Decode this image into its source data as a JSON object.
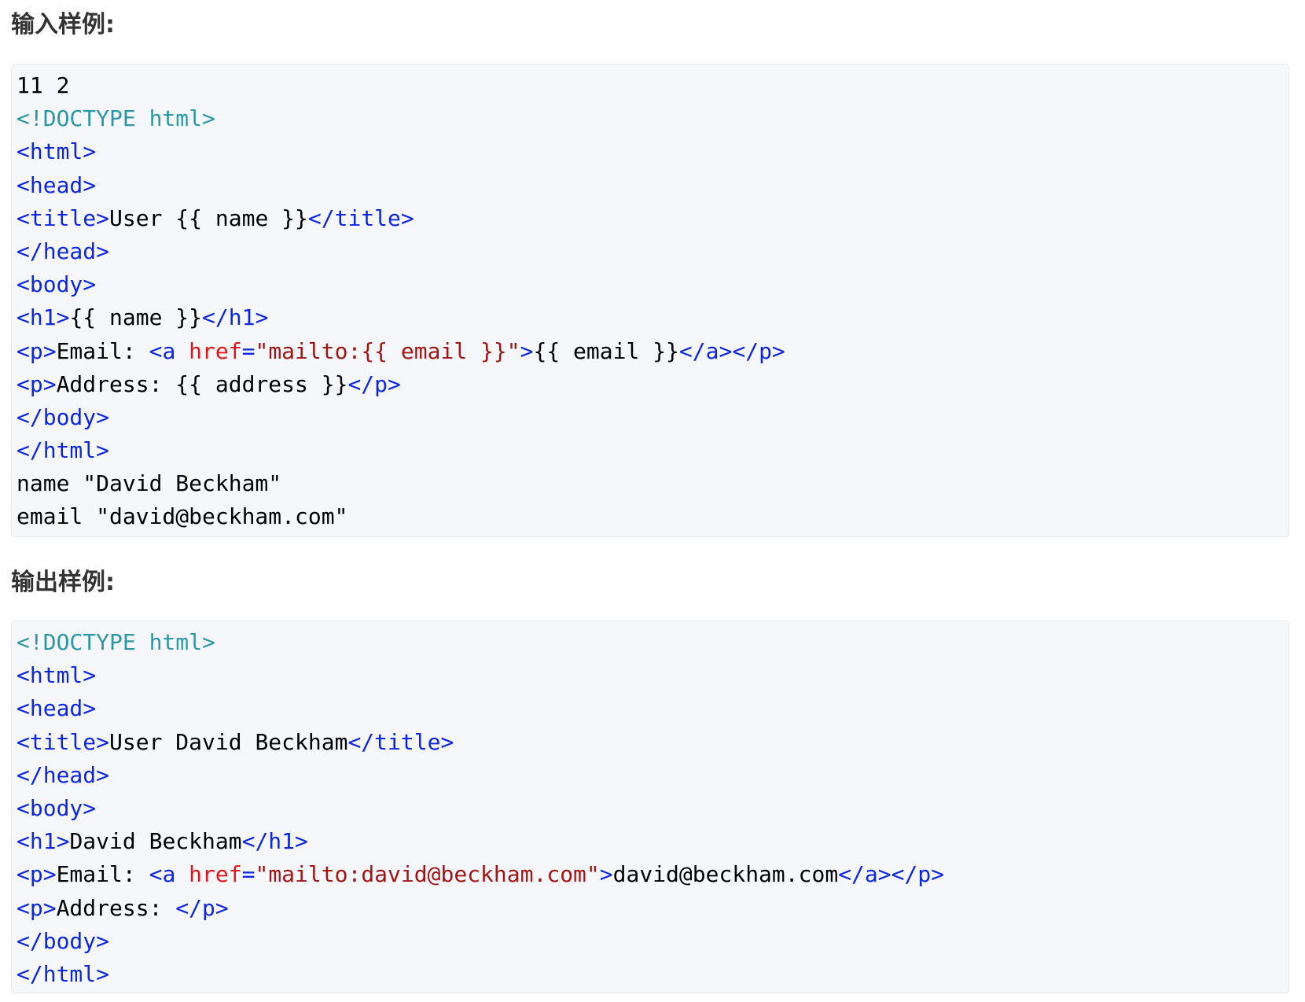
{
  "input_section": {
    "heading": "输入样例:",
    "lines": [
      [
        {
          "t": "text",
          "v": "11 2"
        }
      ],
      [
        {
          "t": "doctype",
          "v": "<!DOCTYPE html>"
        }
      ],
      [
        {
          "t": "tag",
          "v": "<html>"
        }
      ],
      [
        {
          "t": "tag",
          "v": "<head>"
        }
      ],
      [
        {
          "t": "tag",
          "v": "<title>"
        },
        {
          "t": "text",
          "v": "User {{ name }}"
        },
        {
          "t": "tag",
          "v": "</title>"
        }
      ],
      [
        {
          "t": "tag",
          "v": "</head>"
        }
      ],
      [
        {
          "t": "tag",
          "v": "<body>"
        }
      ],
      [
        {
          "t": "tag",
          "v": "<h1>"
        },
        {
          "t": "text",
          "v": "{{ name }}"
        },
        {
          "t": "tag",
          "v": "</h1>"
        }
      ],
      [
        {
          "t": "tag",
          "v": "<p>"
        },
        {
          "t": "text",
          "v": "Email: "
        },
        {
          "t": "tag",
          "v": "<a "
        },
        {
          "t": "attr",
          "v": "href"
        },
        {
          "t": "tag",
          "v": "="
        },
        {
          "t": "str",
          "v": "\"mailto:{{ email }}\""
        },
        {
          "t": "tag",
          "v": ">"
        },
        {
          "t": "text",
          "v": "{{ email }}"
        },
        {
          "t": "tag",
          "v": "</a></p>"
        }
      ],
      [
        {
          "t": "tag",
          "v": "<p>"
        },
        {
          "t": "text",
          "v": "Address: {{ address }}"
        },
        {
          "t": "tag",
          "v": "</p>"
        }
      ],
      [
        {
          "t": "tag",
          "v": "</body>"
        }
      ],
      [
        {
          "t": "tag",
          "v": "</html>"
        }
      ],
      [
        {
          "t": "text",
          "v": "name \"David Beckham\""
        }
      ],
      [
        {
          "t": "text",
          "v": "email \"david@beckham.com\""
        }
      ]
    ]
  },
  "output_section": {
    "heading": "输出样例:",
    "lines": [
      [
        {
          "t": "doctype",
          "v": "<!DOCTYPE html>"
        }
      ],
      [
        {
          "t": "tag",
          "v": "<html>"
        }
      ],
      [
        {
          "t": "tag",
          "v": "<head>"
        }
      ],
      [
        {
          "t": "tag",
          "v": "<title>"
        },
        {
          "t": "text",
          "v": "User David Beckham"
        },
        {
          "t": "tag",
          "v": "</title>"
        }
      ],
      [
        {
          "t": "tag",
          "v": "</head>"
        }
      ],
      [
        {
          "t": "tag",
          "v": "<body>"
        }
      ],
      [
        {
          "t": "tag",
          "v": "<h1>"
        },
        {
          "t": "text",
          "v": "David Beckham"
        },
        {
          "t": "tag",
          "v": "</h1>"
        }
      ],
      [
        {
          "t": "tag",
          "v": "<p>"
        },
        {
          "t": "text",
          "v": "Email: "
        },
        {
          "t": "tag",
          "v": "<a "
        },
        {
          "t": "attr",
          "v": "href"
        },
        {
          "t": "tag",
          "v": "="
        },
        {
          "t": "str",
          "v": "\"mailto:david@beckham.com\""
        },
        {
          "t": "tag",
          "v": ">"
        },
        {
          "t": "text",
          "v": "david@beckham.com"
        },
        {
          "t": "tag",
          "v": "</a></p>"
        }
      ],
      [
        {
          "t": "tag",
          "v": "<p>"
        },
        {
          "t": "text",
          "v": "Address: "
        },
        {
          "t": "tag",
          "v": "</p>"
        }
      ],
      [
        {
          "t": "tag",
          "v": "</body>"
        }
      ],
      [
        {
          "t": "tag",
          "v": "</html>"
        }
      ]
    ]
  },
  "colors": {
    "doctype": "#2d97a6",
    "tag": "#0d26e3",
    "attr": "#e0161a",
    "string": "#a31515",
    "text": "#000000",
    "code_background": "#f5f7fa",
    "heading": "#333333"
  }
}
